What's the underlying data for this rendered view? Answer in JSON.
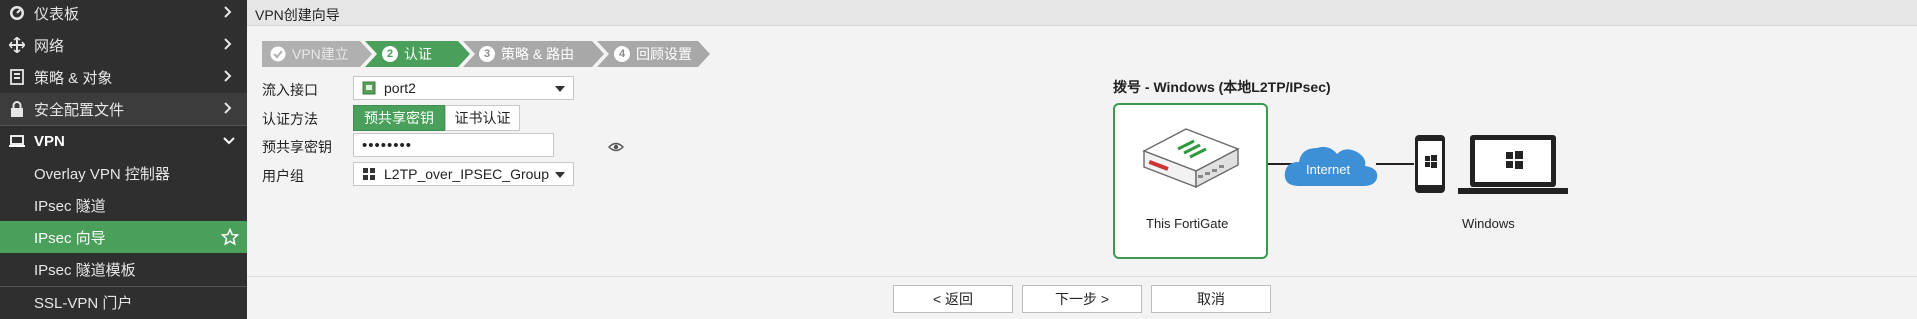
{
  "sidebar": {
    "items": [
      {
        "label": "仪表板",
        "icon": "dashboard-icon"
      },
      {
        "label": "网络",
        "icon": "network-icon"
      },
      {
        "label": "策略 & 对象",
        "icon": "policy-icon"
      },
      {
        "label": "安全配置文件",
        "icon": "lock-icon"
      },
      {
        "label": "VPN",
        "icon": "laptop-icon"
      },
      {
        "label": "Overlay VPN 控制器"
      },
      {
        "label": "IPsec 隧道"
      },
      {
        "label": "IPsec 向导"
      },
      {
        "label": "IPsec 隧道模板"
      },
      {
        "label": "SSL-VPN 门户"
      }
    ]
  },
  "page": {
    "title": "VPN创建向导"
  },
  "wizard": {
    "steps": [
      {
        "num": "✓",
        "label": "VPN建立"
      },
      {
        "num": "2",
        "label": "认证"
      },
      {
        "num": "3",
        "label": "策略 & 路由"
      },
      {
        "num": "4",
        "label": "回顾设置"
      }
    ]
  },
  "form": {
    "incoming_interface_label": "流入接口",
    "incoming_interface_value": "port2",
    "auth_method_label": "认证方法",
    "auth_method_options": [
      "预共享密钥",
      "证书认证"
    ],
    "psk_label": "预共享密钥",
    "psk_value": "••••••••",
    "user_group_label": "用户组",
    "user_group_value": "L2TP_over_IPSEC_Group"
  },
  "diagram": {
    "title": "拨号 - Windows (本地L2TP/IPsec)",
    "fortigate_label": "This FortiGate",
    "internet_label": "Internet",
    "windows_label": "Windows"
  },
  "buttons": {
    "back": "< 返回",
    "next": "下一步 >",
    "cancel": "取消"
  },
  "colors": {
    "sidebar_bg": "#2f2f2f",
    "accent_green": "#4aa05a",
    "step_gray": "#a8a8a8",
    "cloud_blue": "#3d8fd6"
  }
}
